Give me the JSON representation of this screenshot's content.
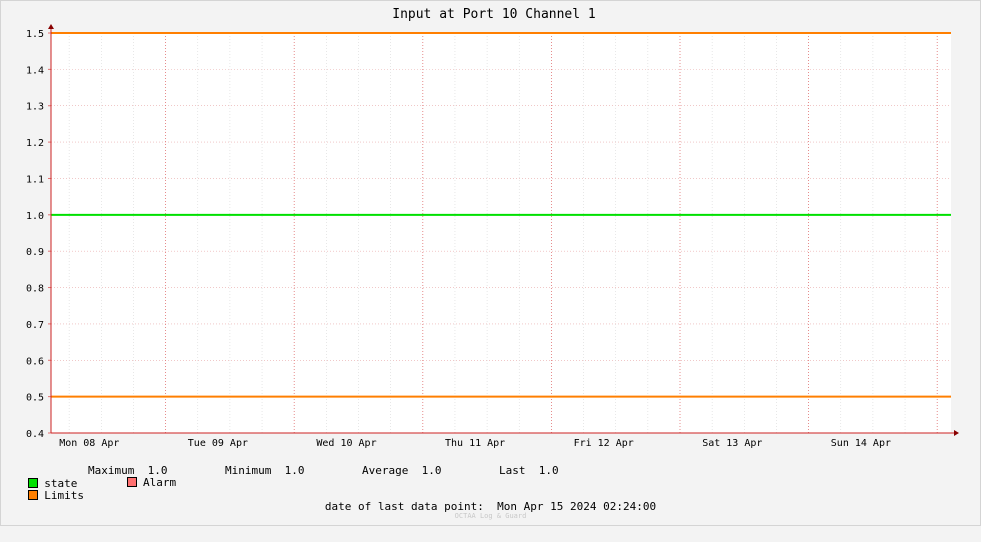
{
  "chart_data": {
    "type": "line",
    "title": "Input at Port 10 Channel 1",
    "ylim": [
      0.4,
      1.5
    ],
    "y_ticks": [
      "0.4",
      "0.5",
      "0.6",
      "0.7",
      "0.8",
      "0.9",
      "1.0",
      "1.1",
      "1.2",
      "1.3",
      "1.4",
      "1.5"
    ],
    "x_labels": [
      "Mon 08 Apr",
      "Tue 09 Apr",
      "Wed 10 Apr",
      "Thu 11 Apr",
      "Fri 12 Apr",
      "Sat 13 Apr",
      "Sun 14 Apr"
    ],
    "grid": true,
    "series": [
      {
        "name": "state",
        "color": "#00e000",
        "values": [
          1.0,
          1.0
        ]
      },
      {
        "name": "Limits",
        "color": "#ff7f00",
        "values": [
          1.5,
          1.5
        ]
      },
      {
        "name": "Limits",
        "color": "#ff7f00",
        "values": [
          0.5,
          0.5
        ]
      }
    ]
  },
  "legend": {
    "state": {
      "label": "state",
      "color": "#00e000"
    },
    "limits": {
      "label": "Limits",
      "color": "#ff7f00"
    },
    "alarm": {
      "label": "Alarm",
      "color": "#ff7070"
    },
    "stats": {
      "max_label": "Maximum",
      "max_value": "1.0",
      "min_label": "Minimum",
      "min_value": "1.0",
      "avg_label": "Average",
      "avg_value": "1.0",
      "last_label": "Last",
      "last_value": "1.0"
    }
  },
  "footer": {
    "label": "date of last data point:",
    "value": "Mon Apr 15 2024 02:24:00",
    "watermark": "OCTAA Log & Guard"
  }
}
